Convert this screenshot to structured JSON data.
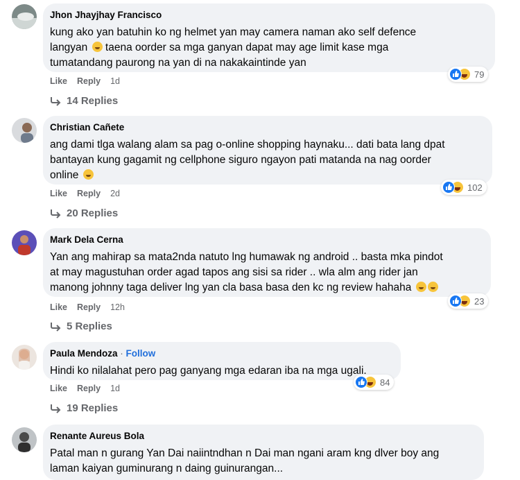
{
  "actions": {
    "like": "Like",
    "reply": "Reply"
  },
  "comments": [
    {
      "author": "Jhon Jhayjhay Francisco",
      "lines": [
        "kung ako yan batuhin ko ng helmet yan may camera naman ako self defence",
        "langyan",
        "taena oorder sa mga ganyan dapat may age limit kase mga",
        "tumatandang paurong na yan di na nakakaintinde yan"
      ],
      "reactions": "79",
      "time": "1d",
      "replies": "14 Replies"
    },
    {
      "author": "Christian Cañete",
      "lines": [
        "ang dami tlga walang alam sa pag o-online shopping haynaku... dati bata lang dpat",
        "bantayan kung gagamit ng cellphone siguro ngayon pati matanda na nag oorder",
        "online"
      ],
      "reactions": "102",
      "time": "2d",
      "replies": "20 Replies"
    },
    {
      "author": "Mark Dela Cerna",
      "lines": [
        "Yan ang mahirap sa mata2nda natuto lng humawak ng android .. basta mka pindot",
        "at may magustuhan order agad tapos ang sisi sa rider .. wla alm ang rider jan",
        "manong johnny taga deliver lng yan cla basa basa den kc ng review hahaha"
      ],
      "reactions": "23",
      "time": "12h",
      "replies": "5 Replies"
    },
    {
      "author": "Paula Mendoza",
      "follow": "Follow",
      "lines": [
        "Hindi ko nilalahat pero pag ganyang mga edaran iba na mga ugali."
      ],
      "reactions": "84",
      "time": "1d",
      "replies": "19 Replies"
    },
    {
      "author": "Renante Aureus Bola",
      "lines": [
        "Patal man n gurang Yan Dai naiintndhan n Dai man ngani aram kng dlver boy ang",
        "laman kaiyan guminurang n daing guinurangan..."
      ]
    }
  ]
}
